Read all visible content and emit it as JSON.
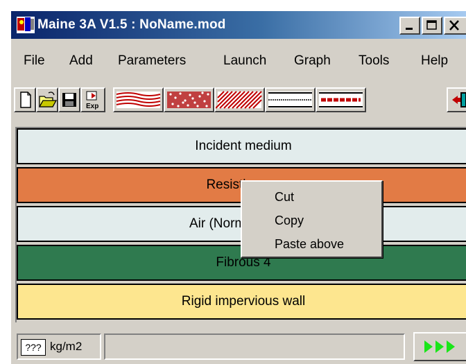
{
  "window": {
    "title": "Maine 3A V1.5 : NoName.mod"
  },
  "menu": {
    "items": [
      "File",
      "Add",
      "Parameters",
      "Launch",
      "Graph",
      "Tools",
      "Help"
    ]
  },
  "toolbar": {
    "buttons": [
      "new-file-icon",
      "open-folder-icon",
      "save-disk-icon",
      "export-icon",
      "fluid-layer-icon",
      "porous-layer-icon",
      "solid-layer-icon",
      "screen-layer-icon",
      "septum-layer-icon",
      "exit-door-icon"
    ]
  },
  "layers": [
    {
      "label": "Incident medium",
      "color": "#e2ecec"
    },
    {
      "label": "Resistive",
      "color": "#e27b45"
    },
    {
      "label": "Air (Normal",
      "color": "#e2ecec"
    },
    {
      "label": "Fibrous 4",
      "color": "#2f7a4f"
    },
    {
      "label": "Rigid impervious wall",
      "color": "#fde68f"
    }
  ],
  "context_menu": {
    "items": [
      "Cut",
      "Copy",
      "Paste above"
    ]
  },
  "status": {
    "value": "???",
    "unit": "kg/m2",
    "run_icon": "run-arrows-icon",
    "run_color": "#19e619"
  }
}
